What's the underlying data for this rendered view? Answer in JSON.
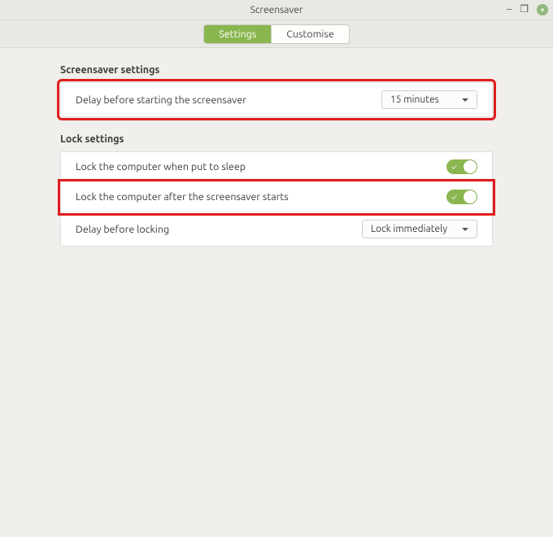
{
  "window": {
    "title": "Screensaver"
  },
  "tabs": {
    "settings": "Settings",
    "customise": "Customise"
  },
  "sections": {
    "screensaver_title": "Screensaver settings",
    "lock_title": "Lock settings"
  },
  "rows": {
    "delay_start": {
      "label": "Delay before starting the screensaver",
      "value": "15 minutes"
    },
    "lock_sleep": {
      "label": "Lock the computer when put to sleep",
      "on": true
    },
    "lock_after_ss": {
      "label": "Lock the computer after the screensaver starts",
      "on": true
    },
    "delay_lock": {
      "label": "Delay before locking",
      "value": "Lock immediately"
    }
  },
  "colors": {
    "accent": "#8ab64f",
    "highlight": "#e11c1c"
  }
}
